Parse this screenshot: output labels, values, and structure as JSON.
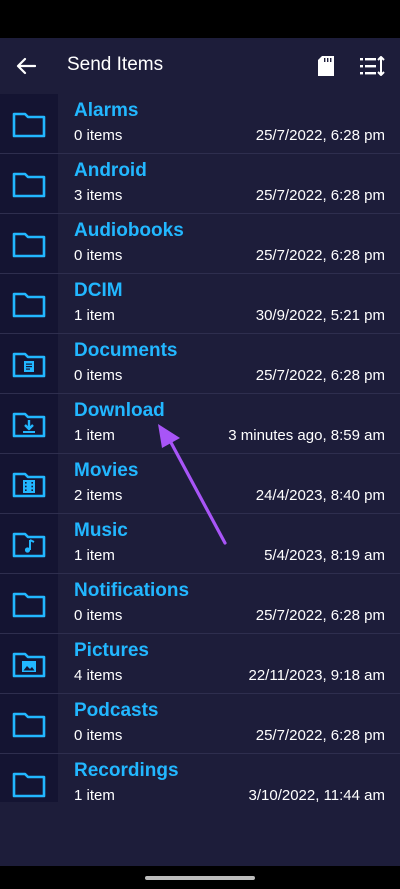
{
  "app_bar": {
    "title": "Send Items",
    "back_icon": "arrow-left-icon",
    "sd_icon": "sd-card-icon",
    "sort_icon": "sort-icon"
  },
  "folders": [
    {
      "name": "Alarms",
      "count": "0 items",
      "date": "25/7/2022, 6:28 pm",
      "icon": "folder-icon"
    },
    {
      "name": "Android",
      "count": "3 items",
      "date": "25/7/2022, 6:28 pm",
      "icon": "folder-icon"
    },
    {
      "name": "Audiobooks",
      "count": "0 items",
      "date": "25/7/2022, 6:28 pm",
      "icon": "folder-icon"
    },
    {
      "name": "DCIM",
      "count": "1 item",
      "date": "30/9/2022, 5:21 pm",
      "icon": "folder-icon"
    },
    {
      "name": "Documents",
      "count": "0 items",
      "date": "25/7/2022, 6:28 pm",
      "icon": "folder-document-icon"
    },
    {
      "name": "Download",
      "count": "1 item",
      "date": "3 minutes ago, 8:59 am",
      "icon": "folder-download-icon"
    },
    {
      "name": "Movies",
      "count": "2 items",
      "date": "24/4/2023, 8:40 pm",
      "icon": "folder-movie-icon"
    },
    {
      "name": "Music",
      "count": "1 item",
      "date": "5/4/2023, 8:19 am",
      "icon": "folder-music-icon"
    },
    {
      "name": "Notifications",
      "count": "0 items",
      "date": "25/7/2022, 6:28 pm",
      "icon": "folder-icon"
    },
    {
      "name": "Pictures",
      "count": "4 items",
      "date": "22/11/2023, 9:18 am",
      "icon": "folder-image-icon"
    },
    {
      "name": "Podcasts",
      "count": "0 items",
      "date": "25/7/2022, 6:28 pm",
      "icon": "folder-icon"
    },
    {
      "name": "Recordings",
      "count": "1 item",
      "date": "3/10/2022, 11:44 am",
      "icon": "folder-icon"
    }
  ],
  "colors": {
    "background": "#1d1d3a",
    "icon_column": "#141432",
    "folder_name": "#22b7ff",
    "annotation_arrow": "#a855f7"
  }
}
